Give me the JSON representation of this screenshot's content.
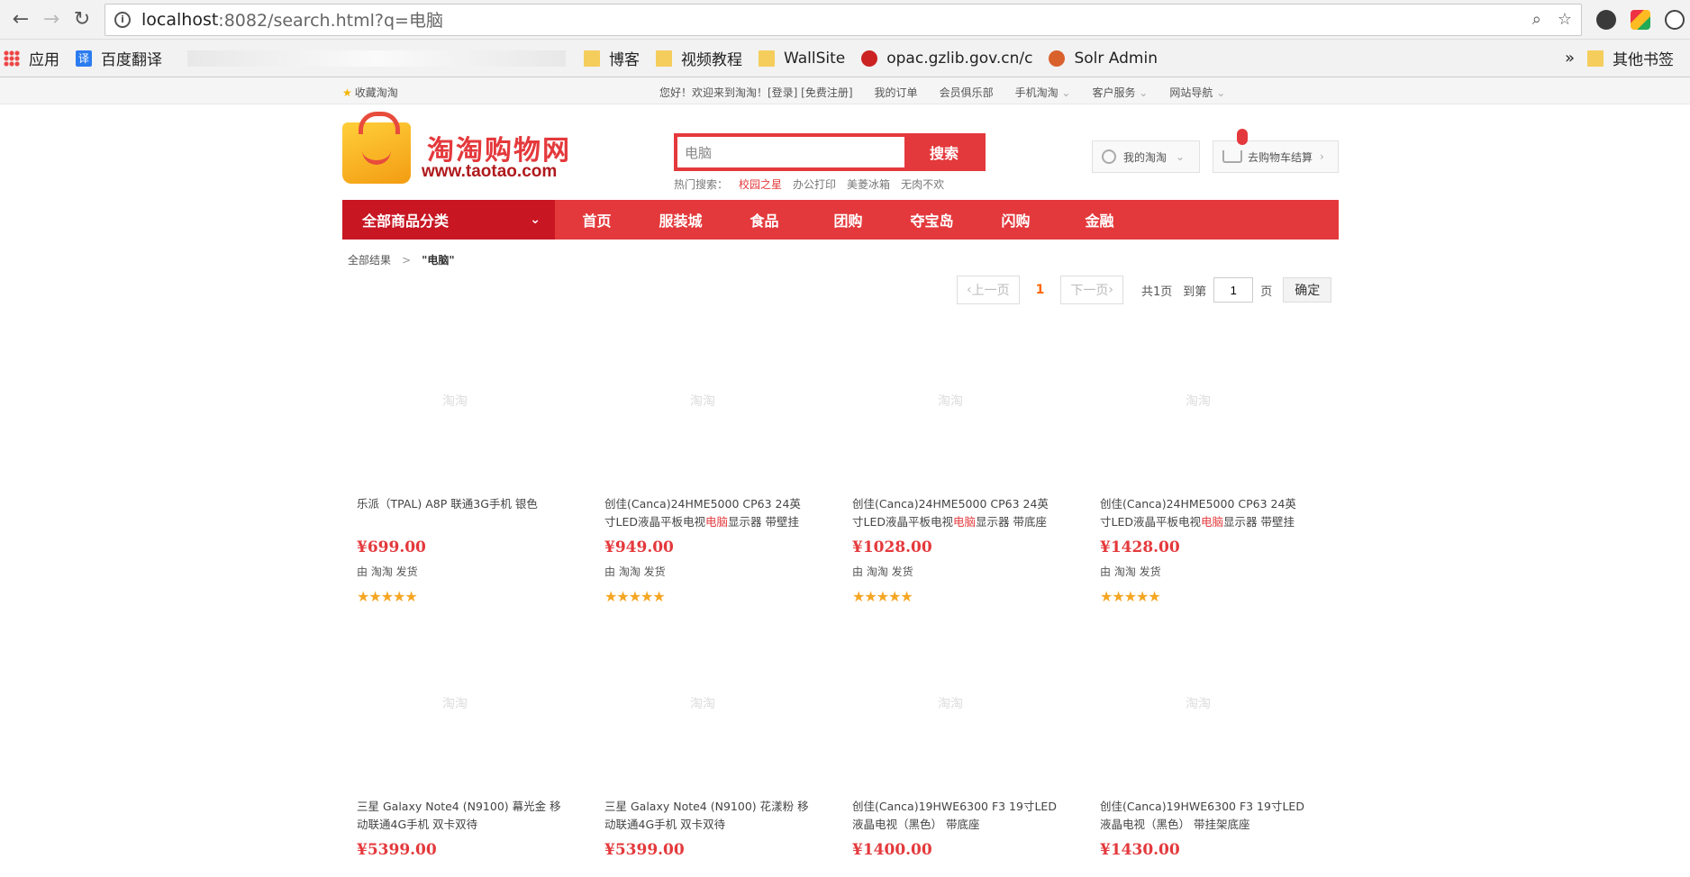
{
  "browser": {
    "url_host": "localhost",
    "url_path": ":8082/search.html?q=电脑",
    "bookmarks": [
      {
        "label": "应用",
        "icon": "apps"
      },
      {
        "label": "百度翻译",
        "icon": "fanyi",
        "glyph": "译"
      },
      {
        "label": "博客",
        "icon": "folder"
      },
      {
        "label": "视频教程",
        "icon": "folder"
      },
      {
        "label": "WallSite",
        "icon": "folder"
      },
      {
        "label": "opac.gzlib.gov.cn/c",
        "icon": "opac"
      },
      {
        "label": "Solr Admin",
        "icon": "solr"
      }
    ],
    "more": "»",
    "other_bookmarks": "其他书签"
  },
  "site": {
    "favorite": "收藏淘淘",
    "top_links": [
      "您好！欢迎来到淘淘！[登录] [免费注册]",
      "我的订单",
      "会员俱乐部",
      "手机淘淘",
      "客户服务",
      "网站导航"
    ],
    "logo_title": "淘淘购物网",
    "logo_url": "www.taotao.com",
    "search_value": "电脑",
    "search_button": "搜索",
    "hot_label": "热门搜索：",
    "hot_words": [
      "校园之星",
      "办公打印",
      "美菱冰箱",
      "无肉不欢"
    ],
    "my_account": "我的淘淘",
    "cart": "去购物车结算",
    "nav_category": "全部商品分类",
    "nav_items": [
      "首页",
      "服装城",
      "食品",
      "团购",
      "夺宝岛",
      "闪购",
      "金融"
    ],
    "crumb_root": "全部结果",
    "crumb_query": "\"电脑\"",
    "pager": {
      "prev": "上一页",
      "current": "1",
      "next": "下一页",
      "total": "共1页",
      "goto": "到第",
      "goto_value": "1",
      "page_unit": "页",
      "confirm": "确定"
    },
    "placeholder_text": "淘淘",
    "products": [
      {
        "pre": "乐派（TPAL) A8P 联通3G手机 银色",
        "hl": "",
        "post": "",
        "price": "¥699.00",
        "seller": "由 淘淘 发货",
        "stars": "★★★★★"
      },
      {
        "pre": "创佳(Canca)24HME5000 CP63 24英寸LED液晶平板电视",
        "hl": "电脑",
        "post": "显示器 带壁挂底座",
        "price": "¥949.00",
        "seller": "由 淘淘 发货",
        "stars": "★★★★★"
      },
      {
        "pre": "创佳(Canca)24HME5000 CP63 24英寸LED液晶平板电视",
        "hl": "电脑",
        "post": "显示器 带底座+礼包",
        "price": "¥1028.00",
        "seller": "由 淘淘 发货",
        "stars": "★★★★★"
      },
      {
        "pre": "创佳(Canca)24HME5000 CP63 24英寸LED液晶平板电视",
        "hl": "电脑",
        "post": "显示器 带壁挂底座",
        "price": "¥1428.00",
        "seller": "由 淘淘 发货",
        "stars": "★★★★★"
      },
      {
        "pre": "三星 Galaxy Note4 (N9100) 幕光金 移动联通4G手机 双卡双待",
        "hl": "",
        "post": "",
        "price": "¥5399.00",
        "seller": "",
        "stars": ""
      },
      {
        "pre": "三星 Galaxy Note4 (N9100) 花漾粉 移动联通4G手机 双卡双待",
        "hl": "",
        "post": "",
        "price": "¥5399.00",
        "seller": "",
        "stars": ""
      },
      {
        "pre": "创佳(Canca)19HWE6300 F3 19寸LED液晶电视（黑色） 带底座",
        "hl": "",
        "post": "",
        "price": "¥1400.00",
        "seller": "",
        "stars": ""
      },
      {
        "pre": "创佳(Canca)19HWE6300 F3 19寸LED液晶电视（黑色） 带挂架底座",
        "hl": "",
        "post": "",
        "price": "¥1430.00",
        "seller": "",
        "stars": ""
      }
    ]
  }
}
